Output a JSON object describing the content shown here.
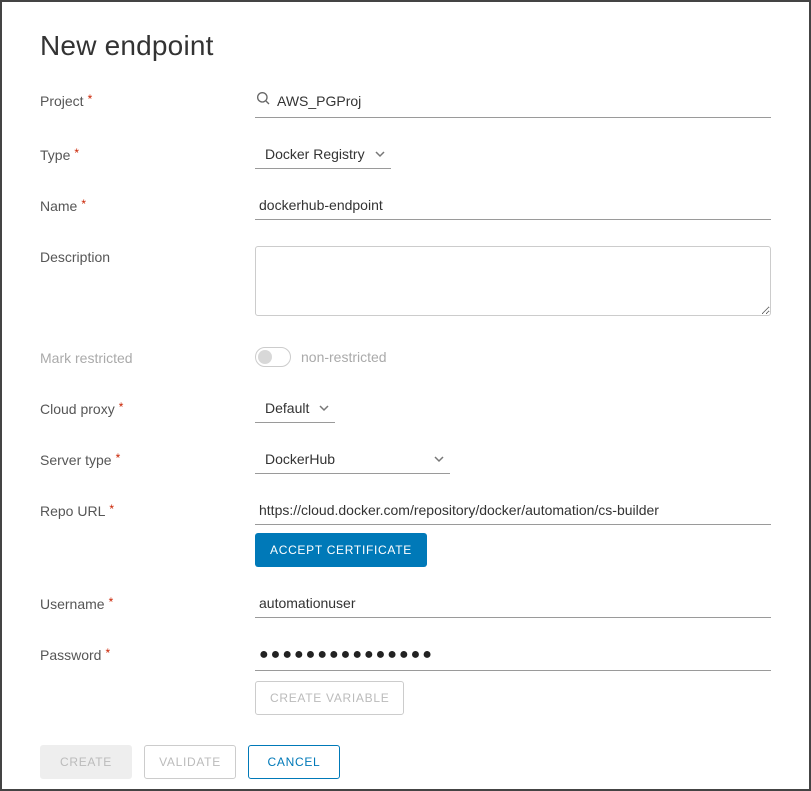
{
  "title": "New endpoint",
  "labels": {
    "project": "Project",
    "type": "Type",
    "name": "Name",
    "description": "Description",
    "mark_restricted": "Mark restricted",
    "cloud_proxy": "Cloud proxy",
    "server_type": "Server type",
    "repo_url": "Repo URL",
    "username": "Username",
    "password": "Password"
  },
  "values": {
    "project": "AWS_PGProj",
    "type": "Docker Registry",
    "name": "dockerhub-endpoint",
    "description": "",
    "mark_restricted_state": "non-restricted",
    "cloud_proxy": "Default",
    "server_type": "DockerHub",
    "repo_url": "https://cloud.docker.com/repository/docker/automation/cs-builder",
    "username": "automationuser",
    "password_mask": "●●●●●●●●●●●●●●●"
  },
  "buttons": {
    "accept_certificate": "Accept Certificate",
    "create_variable": "Create Variable",
    "create": "Create",
    "validate": "Validate",
    "cancel": "Cancel"
  }
}
